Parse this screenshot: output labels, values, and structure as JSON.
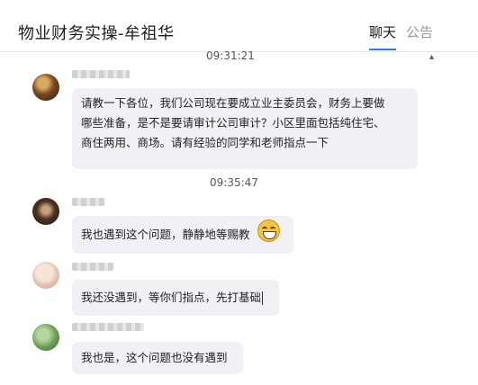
{
  "header": {
    "title": "物业财务实操-牟祖华",
    "tabs": [
      {
        "label": "聊天",
        "active": true
      },
      {
        "label": "公告",
        "active": false
      }
    ],
    "accent_color": "#2f7bd9"
  },
  "timestamps": [
    "09:31:21",
    "09:35:47"
  ],
  "messages": [
    {
      "text_lines": [
        "请教一下各位，我们公司现在要成立业主委员会，财务上要做",
        "哪些准备，是不是要请审计公司审计？小区里面包括纯住宅、",
        "商住两用、商场。请有经验的同学和老师指点一下"
      ]
    },
    {
      "text": "我也遇到这个问题，静静地等赐教",
      "emoji": "grin-face-icon"
    },
    {
      "text": "我还没遇到，等你们指点，先打基础"
    },
    {
      "text": "我也是，这个问题也没有遇到"
    }
  ]
}
